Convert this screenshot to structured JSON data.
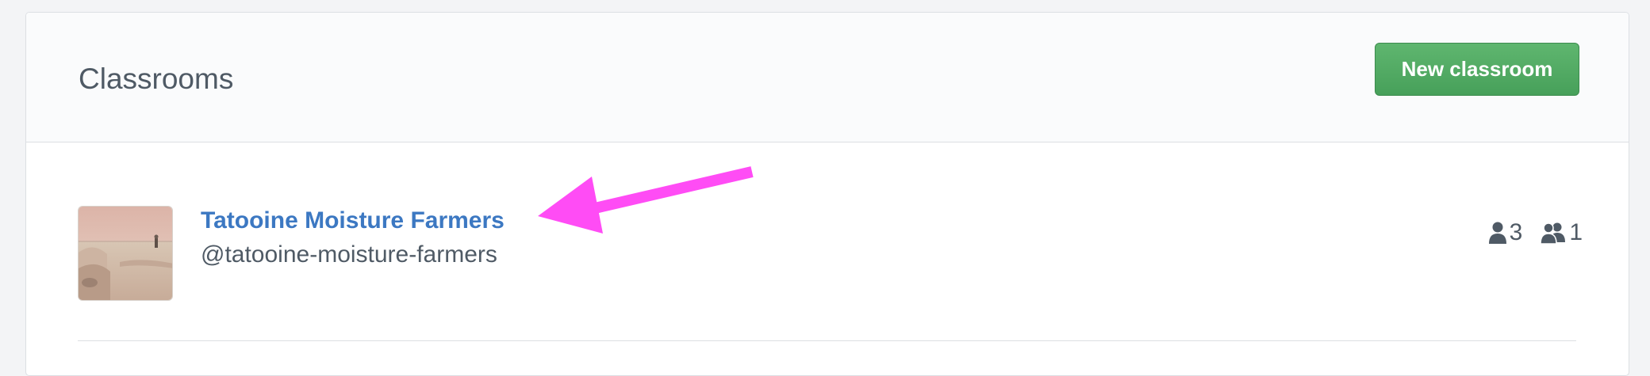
{
  "header": {
    "title": "Classrooms",
    "new_button_label": "New classroom"
  },
  "classrooms": [
    {
      "name": "Tatooine Moisture Farmers",
      "handle": "@tatooine-moisture-farmers",
      "members_count": "3",
      "teams_count": "1"
    }
  ],
  "colors": {
    "link": "#3c78c2",
    "primary_button": "#4ca55e",
    "annotation_arrow": "#ff4cf5",
    "text_muted": "#4f5a65"
  },
  "icons": {
    "member": "person-icon",
    "team": "people-icon"
  }
}
